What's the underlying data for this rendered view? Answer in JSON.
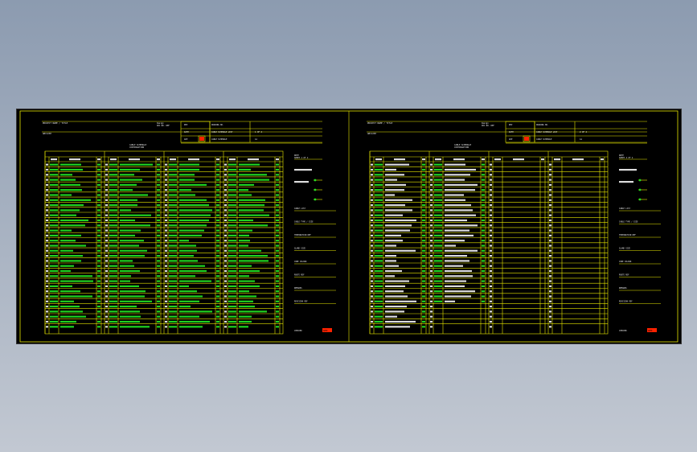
{
  "app": {
    "background": "#000000",
    "line_color": "#e8e800",
    "text_color": "#e8e8e8",
    "data_color": "#22dd22",
    "stamp_color": "#ff2200"
  },
  "sheets": [
    {
      "name": "left",
      "header_left_top": "PROJECT NAME / TITLE",
      "header_left_bottom": "ABC123H",
      "header_mid_top": "Design\nDOC NO. REF",
      "rev_labels": [
        "REV",
        "DATE",
        "APP"
      ],
      "doc_labels": [
        "DRAWING NO.",
        "CABLE SCHEDULE LIST",
        "CABLE SCHEDULE"
      ],
      "doc_values": [
        "",
        "1 OF 2",
        "A1"
      ],
      "table_title": "CABLE SCHEDULE\nCONTINUATION",
      "notes_title": "NOTE\nSHEET 1 OF 2",
      "notes": [
        "CABLE LIST",
        "CABLE TYPE / SIZE",
        "TERMINATION REF",
        "GLAND SIZE",
        "CORE COLOUR",
        "ROUTE REF",
        "REMARKS",
        "REVISION REF"
      ],
      "footer_label": "CHECKED",
      "stamp": "APPD"
    },
    {
      "name": "right",
      "header_left_top": "PROJECT NAME / TITLE",
      "header_left_bottom": "ABC123H",
      "header_mid_top": "Design\nDOC NO. REF",
      "rev_labels": [
        "REV",
        "DATE",
        "APP"
      ],
      "doc_labels": [
        "DRAWING NO.",
        "CABLE SCHEDULE LIST",
        "CABLE SCHEDULE"
      ],
      "doc_values": [
        "",
        "2 OF 2",
        "A1"
      ],
      "table_title": "CABLE SCHEDULE\nCONTINUATION",
      "notes_title": "NOTE\nSHEET 2 OF 2",
      "notes": [
        "CABLE LIST",
        "CABLE TYPE / SIZE",
        "TERMINATION REF",
        "GLAND SIZE",
        "CORE COLOUR",
        "ROUTE REF",
        "REMARKS",
        "REVISION REF"
      ],
      "footer_label": "CHECKED",
      "stamp": "APPD"
    }
  ]
}
